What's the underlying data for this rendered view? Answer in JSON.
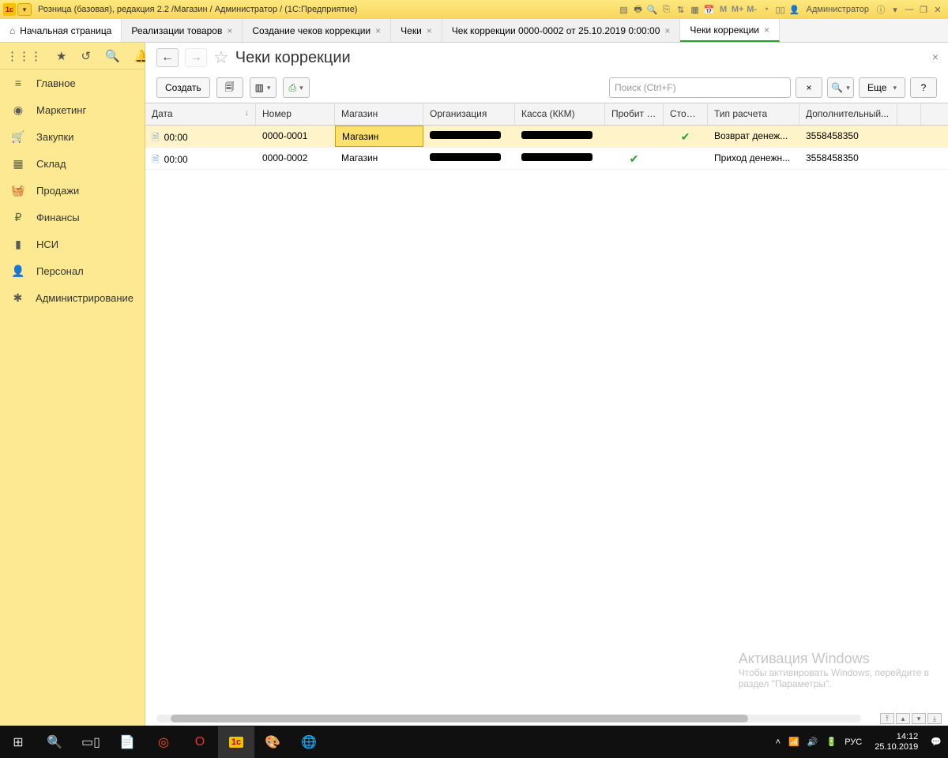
{
  "titlebar": {
    "title": "Розница (базовая), редакция 2.2 /Магазин / Администратор /  (1С:Предприятие)",
    "user": "Администратор",
    "m_labels": [
      "M",
      "M+",
      "M-"
    ]
  },
  "tabs": [
    {
      "label": "Начальная страница",
      "closable": false,
      "home": true,
      "active": false
    },
    {
      "label": "Реализации товаров",
      "closable": true,
      "active": false
    },
    {
      "label": "Создание чеков коррекции",
      "closable": true,
      "active": false
    },
    {
      "label": "Чеки",
      "closable": true,
      "active": false
    },
    {
      "label": "Чек коррекции 0000-0002 от 25.10.2019 0:00:00",
      "closable": true,
      "active": false
    },
    {
      "label": "Чеки коррекции",
      "closable": true,
      "active": true
    }
  ],
  "sidebar": {
    "items": [
      {
        "icon": "🏠",
        "label": "Главное"
      },
      {
        "icon": "◉",
        "label": "Маркетинг"
      },
      {
        "icon": "🛒",
        "label": "Закупки"
      },
      {
        "icon": "▦",
        "label": "Склад"
      },
      {
        "icon": "🧺",
        "label": "Продажи"
      },
      {
        "icon": "₽",
        "label": "Финансы"
      },
      {
        "icon": "▮",
        "label": "НСИ"
      },
      {
        "icon": "👤",
        "label": "Персонал"
      },
      {
        "icon": "✱",
        "label": "Администрирование"
      }
    ]
  },
  "page": {
    "title": "Чеки коррекции",
    "create_label": "Создать",
    "more_label": "Еще",
    "search_placeholder": "Поиск (Ctrl+F)"
  },
  "table": {
    "columns": [
      "Дата",
      "Номер",
      "Магазин",
      "Организация",
      "Касса (ККМ)",
      "Пробит чек",
      "Сторно",
      "Тип расчета",
      "Дополнительный...",
      ""
    ],
    "rows": [
      {
        "date": "00:00",
        "num": "0000-0001",
        "shop": "Магазин",
        "org": "[redacted]",
        "kassa": "[redacted]",
        "probit": "",
        "storno": "✔",
        "type": "Возврат денеж...",
        "extra": "3558458350",
        "selected": true
      },
      {
        "date": "00:00",
        "num": "0000-0002",
        "shop": "Магазин",
        "org": "[redacted]",
        "kassa": "[redacted]",
        "probit": "✔",
        "storno": "",
        "type": "Приход денежн...",
        "extra": "3558458350",
        "selected": false
      }
    ]
  },
  "watermark": {
    "title": "Активация Windows",
    "sub1": "Чтобы активировать Windows, перейдите в",
    "sub2": "раздел \"Параметры\"."
  },
  "taskbar": {
    "lang": "РУС",
    "time": "14:12",
    "date": "25.10.2019"
  }
}
